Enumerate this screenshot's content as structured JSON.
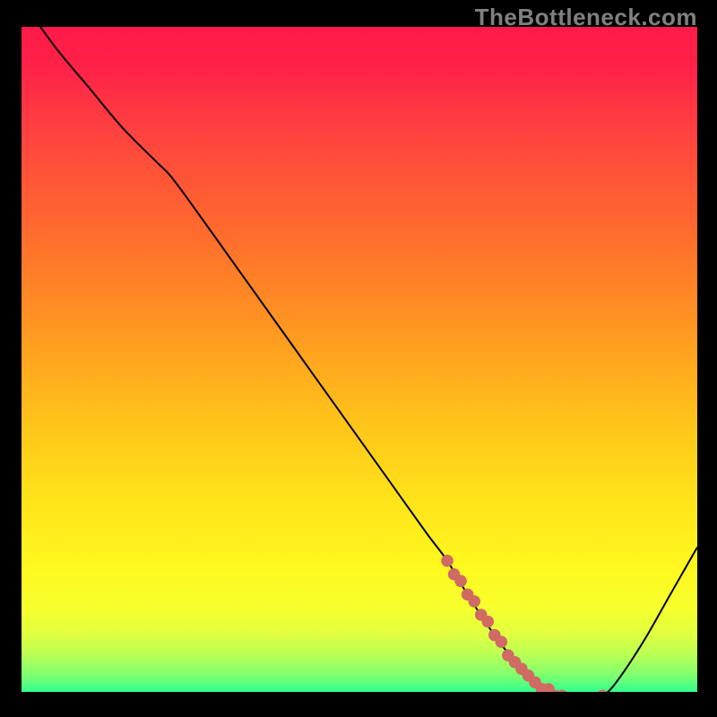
{
  "watermark": "TheBottleneck.com",
  "chart_data": {
    "type": "line",
    "title": "",
    "xlabel": "",
    "ylabel": "",
    "xlim": [
      0,
      100
    ],
    "ylim": [
      0,
      100
    ],
    "series": [
      {
        "name": "bottleneck-curve",
        "x": [
          0,
          5,
          10,
          15,
          20,
          22,
          25,
          30,
          35,
          40,
          45,
          50,
          55,
          60,
          63,
          66,
          70,
          74,
          78,
          80,
          82,
          84,
          86,
          88,
          92,
          96,
          100
        ],
        "y": [
          104,
          97,
          91,
          85,
          80,
          78,
          74,
          67,
          60,
          53,
          46,
          39,
          32,
          25,
          21,
          16,
          10,
          5,
          2,
          1,
          0,
          0,
          1,
          3,
          9,
          16,
          23
        ]
      }
    ],
    "highlight_points": {
      "name": "marked-range",
      "color": "#cf6b63",
      "x": [
        63,
        64,
        65,
        66,
        67,
        68,
        69,
        70,
        71,
        72,
        73,
        74,
        75,
        76,
        77,
        78,
        79,
        80,
        81,
        83,
        84,
        86
      ],
      "y": [
        21,
        19,
        18,
        16,
        15,
        13,
        12,
        10,
        9,
        7,
        6,
        5,
        4,
        3,
        2,
        2,
        1,
        1,
        0,
        0,
        0,
        1
      ]
    },
    "gradient_stops": [
      {
        "offset": 0.0,
        "color": "#ff1a49"
      },
      {
        "offset": 0.06,
        "color": "#ff2248"
      },
      {
        "offset": 0.15,
        "color": "#ff4040"
      },
      {
        "offset": 0.3,
        "color": "#ff6a2e"
      },
      {
        "offset": 0.45,
        "color": "#ff9820"
      },
      {
        "offset": 0.58,
        "color": "#ffc21a"
      },
      {
        "offset": 0.7,
        "color": "#ffe31a"
      },
      {
        "offset": 0.8,
        "color": "#fff81f"
      },
      {
        "offset": 0.86,
        "color": "#f7ff2d"
      },
      {
        "offset": 0.9,
        "color": "#dfff40"
      },
      {
        "offset": 0.93,
        "color": "#b8ff55"
      },
      {
        "offset": 0.96,
        "color": "#7dff70"
      },
      {
        "offset": 0.985,
        "color": "#2fff90"
      },
      {
        "offset": 1.0,
        "color": "#00e878"
      }
    ]
  }
}
